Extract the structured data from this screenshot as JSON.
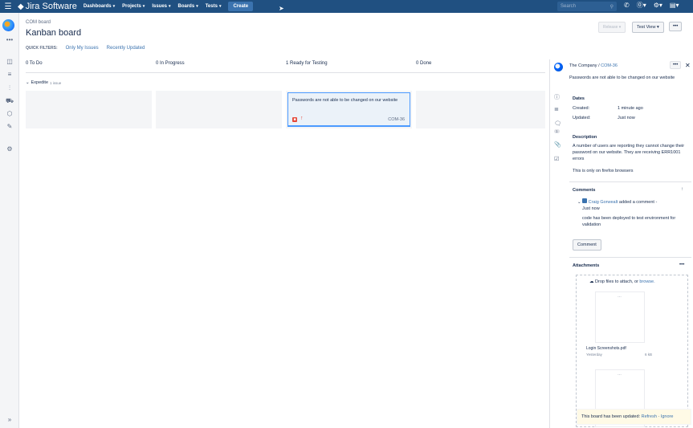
{
  "topbar": {
    "app_name": "Jira Software",
    "nav": [
      {
        "label": "Dashboards"
      },
      {
        "label": "Projects"
      },
      {
        "label": "Issues"
      },
      {
        "label": "Boards"
      },
      {
        "label": "Tests"
      }
    ],
    "create_label": "Create",
    "search_placeholder": "Search",
    "icons": [
      "search-icon",
      "feed-icon",
      "help-icon",
      "settings-icon",
      "profile-icon"
    ]
  },
  "sidebar": {
    "icons": [
      "project-avatar",
      "more-icon",
      "board-icon",
      "backlog-icon",
      "reports-icon",
      "releases-icon",
      "components-icon",
      "tests-icon",
      "settings-icon",
      "expand-icon"
    ]
  },
  "board": {
    "breadcrumb": "COM board",
    "title": "Kanban board",
    "quick_filters_label": "QUICK FILTERS:",
    "filters": [
      "Only My Issues",
      "Recently Updated"
    ],
    "release_label": "Release",
    "view_label": "Test View",
    "more_label": "•••",
    "columns": [
      {
        "label": "0 To Do"
      },
      {
        "label": "0 In Progress"
      },
      {
        "label": "1 Ready for Testing"
      },
      {
        "label": "0 Done"
      }
    ],
    "swimlane": {
      "label": "Expedite",
      "count": "1 issue"
    },
    "card": {
      "summary": "Passwords are not able to be changed on our website",
      "key": "COM-36"
    }
  },
  "detail": {
    "project": "The Company /",
    "issue_key": "COM-36",
    "more_label": "•••",
    "close_label": "✕",
    "summary": "Passwords are not able to be changed on our website",
    "dates_heading": "Dates",
    "created_label": "Created:",
    "created_value": "1 minute ago",
    "updated_label": "Updated:",
    "updated_value": "Just now",
    "comment_count": "1",
    "description_heading": "Description",
    "description": "A number of users are reporting they cannot change their password on our website. They are receiving ERR1001 errors",
    "description_extra": "This is only on firefox browsers",
    "comments_heading": "Comments",
    "comment_author": "Craig Gorwealt",
    "comment_action": "added a comment -",
    "comment_time": "Just now",
    "comment_body": "code has been deployed to test environment for validation",
    "comment_button": "Comment",
    "attachments_heading": "Attachments",
    "attachments_more": "•••",
    "drop_text": "Drop files to attach, or",
    "drop_link": "browse.",
    "attachment_name": "Login Screenshots.pdf",
    "attachment_date": "Yesterday",
    "attachment_size": "6 kB"
  },
  "toast": {
    "text": "This board has been updated:",
    "refresh": "Refresh",
    "separator": "·",
    "ignore": "Ignore"
  }
}
